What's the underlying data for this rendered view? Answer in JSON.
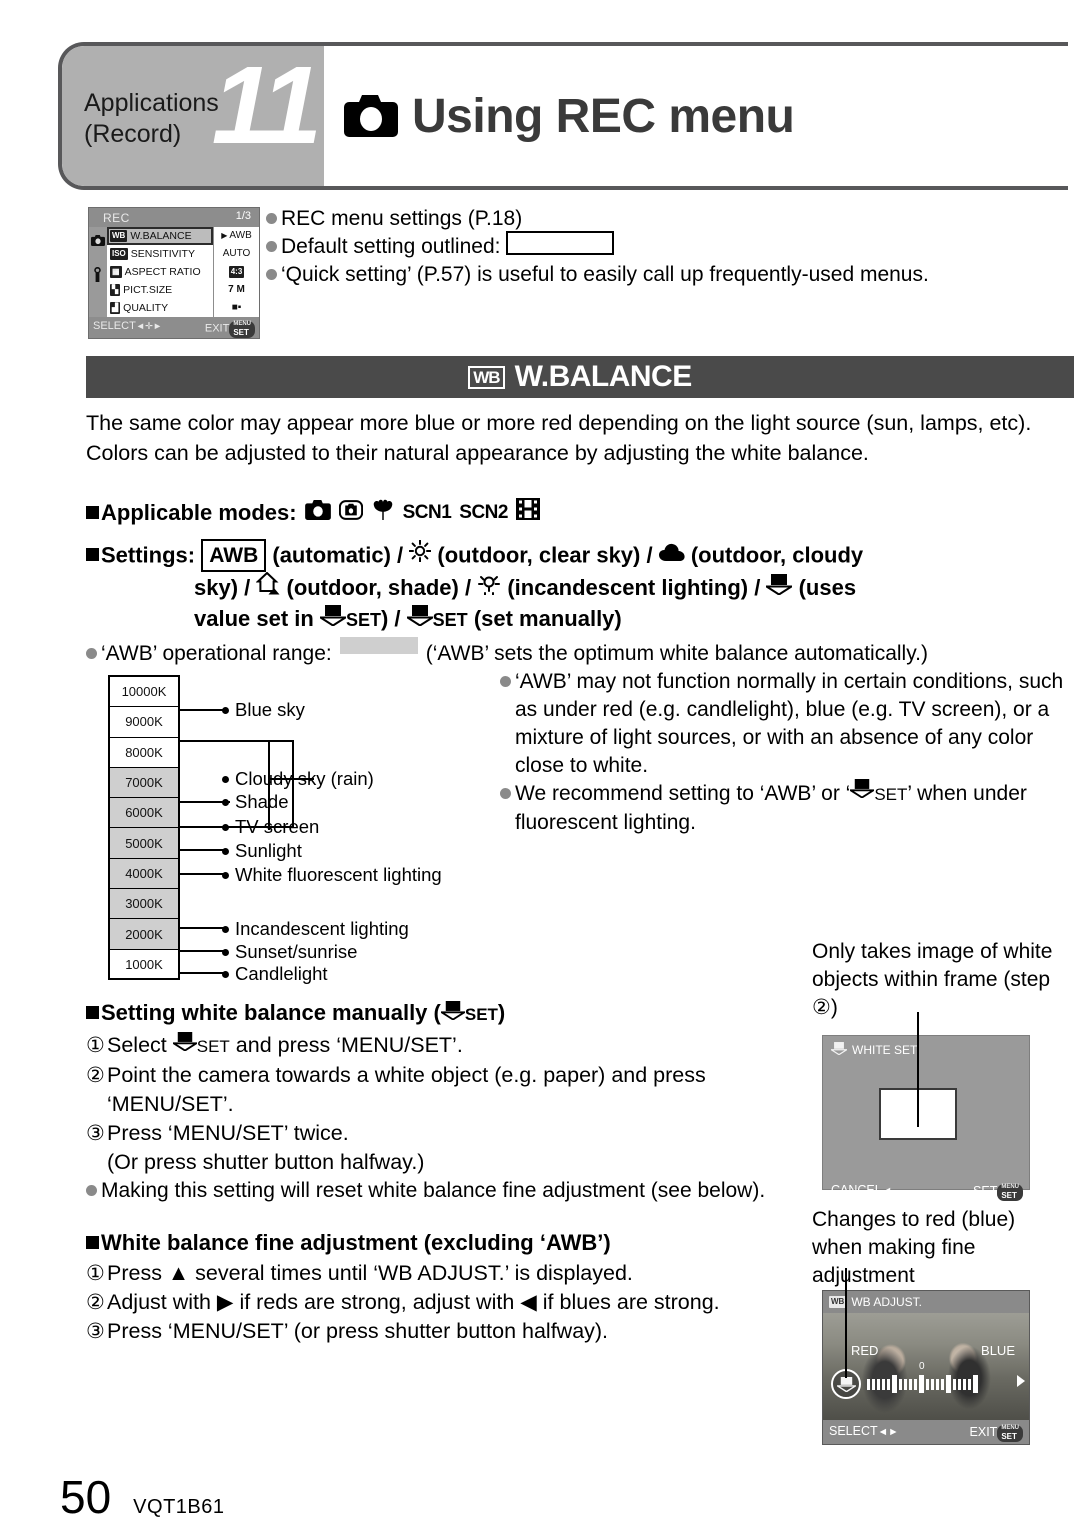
{
  "header": {
    "chapter_label": "Applications\n(Record)",
    "chapter_number": "11",
    "title": "Using REC menu",
    "camera_icon": "camera-icon"
  },
  "rec_lcd": {
    "title": "REC",
    "page_indicator": "1/3",
    "rows": [
      {
        "tag": "WB",
        "label": "W.BALANCE",
        "value": "AWB",
        "selected": true,
        "marker": "▶"
      },
      {
        "tag": "ISO",
        "label": "SENSITIVITY",
        "value": "AUTO",
        "selected": false,
        "marker": ""
      },
      {
        "tag": "AR",
        "label": "ASPECT RATIO",
        "value": "4:3",
        "selected": false,
        "marker": ""
      },
      {
        "tag": "PS",
        "label": "PICT.SIZE",
        "value": "7 M",
        "selected": false,
        "marker": ""
      },
      {
        "tag": "QL",
        "label": "QUALITY",
        "value": "■▪",
        "selected": false,
        "marker": ""
      }
    ],
    "footer_select": "SELECT",
    "footer_exit": "EXIT",
    "menu_btn_top": "MENU",
    "menu_btn_bottom": "SET",
    "sidebar_icons": [
      "camera-icon",
      "wrench-icon"
    ]
  },
  "top_notes": [
    "REC menu settings (P.18)",
    "Default setting outlined:",
    "‘Quick setting’ (P.57) is useful to easily call up frequently-used menus."
  ],
  "section": {
    "badge": "WB",
    "title": "W.BALANCE",
    "intro": "The same color may appear more blue or more red depending on the light source (sun, lamps, etc). Colors can be adjusted to their natural appearance by adjusting the white balance."
  },
  "applicable": {
    "label": "Applicable modes:",
    "modes": [
      "camera-icon",
      "intelligent-auto-icon",
      "macro-tulip-icon",
      "SCN1",
      "SCN2",
      "movie-film-icon"
    ]
  },
  "settings": {
    "label": "Settings:",
    "awb_box": "AWB",
    "line1_a": "(automatic) /",
    "line1_b": "(outdoor, clear sky) /",
    "line1_c": "(outdoor, cloudy",
    "line2_a": "sky) /",
    "line2_b": "(outdoor, shade) /",
    "line2_c": "(incandescent lighting) /",
    "line2_d": "(uses",
    "line3_a": "value set in",
    "line3_b": ") /",
    "line3_c": "(set manually)",
    "set_label": "SET"
  },
  "awb_range": {
    "prefix": "‘AWB’ operational range:",
    "suffix": "(‘AWB’ sets the optimum white balance automatically.)",
    "swatch_color": "#cfcfcf"
  },
  "kelvin_scale": {
    "ticks": [
      "10000K",
      "9000K",
      "8000K",
      "7000K",
      "6000K",
      "5000K",
      "4000K",
      "3000K",
      "2000K",
      "1000K"
    ],
    "shaded_from": "8000K",
    "shaded_to": "2000K",
    "labels": [
      {
        "text": "Blue sky",
        "tick": "9000K"
      },
      {
        "text": "Cloudy sky (rain)",
        "tick": "7000K"
      },
      {
        "text": "Shade",
        "tick": "7000K"
      },
      {
        "text": "TV screen",
        "tick": "6000K"
      },
      {
        "text": "Sunlight",
        "tick": "5000K"
      },
      {
        "text": "White fluorescent lighting",
        "tick": "4000K"
      },
      {
        "text": "Incandescent lighting",
        "tick": "2000K"
      },
      {
        "text": "Sunset/sunrise",
        "tick": "2000K"
      },
      {
        "text": "Candlelight",
        "tick": "1000K"
      }
    ]
  },
  "awb_notes": [
    "‘AWB’ may not function normally in certain conditions, such as under red (e.g. candlelight), blue (e.g. TV screen), or a mixture of light sources, or with an absence of any color close to white.",
    "We recommend setting to ‘AWB’ or ‘"
  ],
  "awb_note2_tail": "’ when under fluorescent lighting.",
  "manual": {
    "heading_a": "Setting white balance manually (",
    "heading_b": ")",
    "set_label": "SET",
    "step1_a": "Select",
    "step1_b": "and press ‘MENU/SET’.",
    "step2": "Point the camera towards a white object (e.g. paper) and press ‘MENU/SET’.",
    "step3": "Press ‘MENU/SET’ twice.",
    "step3_sub": "(Or press shutter button halfway.)",
    "bullet": "Making this setting will reset white balance fine adjustment (see below).",
    "num1": "①",
    "num2": "②",
    "num3": "③"
  },
  "fine": {
    "heading": "White balance fine adjustment (excluding ‘AWB’)",
    "step1": "Press ▲ several times until ‘WB ADJUST.’ is displayed.",
    "step2": "Adjust with ▶ if reds are strong, adjust with ◀ if blues are strong.",
    "step3": "Press ‘MENU/SET’ (or press shutter button halfway).",
    "num1": "①",
    "num2": "②",
    "num3": "③"
  },
  "callout_white": {
    "text": "Only takes image of white objects within frame (step ②)",
    "lcd": {
      "title": "WHITE SET",
      "cancel": "CANCEL",
      "set": "SET",
      "menu_btn_top": "MENU",
      "menu_btn_bottom": "SET"
    }
  },
  "callout_wbadj": {
    "text": "Changes to red (blue) when making fine adjustment",
    "lcd": {
      "title": "WB ADJUST.",
      "badge": "WB",
      "red": "RED",
      "blue": "BLUE",
      "center_value": "0",
      "select": "SELECT",
      "exit": "EXIT",
      "menu_btn_top": "MENU",
      "menu_btn_bottom": "SET"
    }
  },
  "footer": {
    "page_number": "50",
    "document_id": "VQT1B61"
  }
}
